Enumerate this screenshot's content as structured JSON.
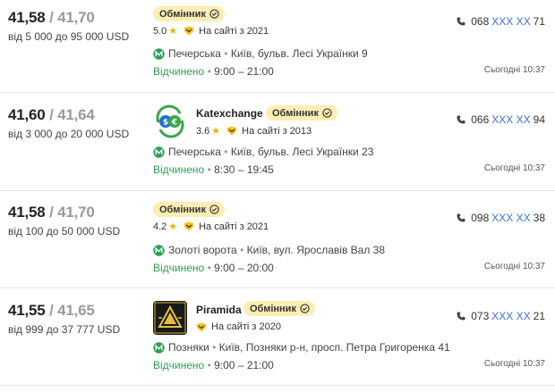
{
  "offers": [
    {
      "buy": "41,58",
      "sell": "41,70",
      "range": "від 5 000 до 95 000 USD",
      "name": "",
      "badge": "Обмінник",
      "rating": "5.0",
      "since": "На сайті з 2021",
      "metro": "Печерська",
      "address": "Київ, бульв. Лесі Українки 9",
      "status": "Відчинено",
      "hours": "9:00 – 21:00",
      "phone_prefix": "068",
      "phone_hidden": "XXX XX",
      "phone_suffix": "71",
      "updated": "Сьогодні 10:37"
    },
    {
      "buy": "41,60",
      "sell": "41,64",
      "range": "від 3 000 до 20 000 USD",
      "name": "Katexchange",
      "badge": "Обмінник",
      "rating": "3.6",
      "since": "На сайті з 2013",
      "metro": "Печерська",
      "address": "Київ, бульв. Лесі Українки 23",
      "status": "Відчинено",
      "hours": "8:30 – 19:45",
      "phone_prefix": "066",
      "phone_hidden": "XXX XX",
      "phone_suffix": "94",
      "updated": "Сьогодні 10:37"
    },
    {
      "buy": "41,58",
      "sell": "41,70",
      "range": "від 100 до 50 000 USD",
      "name": "",
      "badge": "Обмінник",
      "rating": "4.2",
      "since": "На сайті з 2021",
      "metro": "Золоті ворота",
      "address": "Київ, вул. Ярославів Вал 38",
      "status": "Відчинено",
      "hours": "9:00 – 20:00",
      "phone_prefix": "098",
      "phone_hidden": "XXX XX",
      "phone_suffix": "38",
      "updated": "Сьогодні 10:37"
    },
    {
      "buy": "41,55",
      "sell": "41,65",
      "range": "від 999 до 37 777 USD",
      "name": "Piramida",
      "badge": "Обмінник",
      "rating": "",
      "since": "На сайті з 2020",
      "metro": "Позняки",
      "address": "Київ, Позняки р-н, просп. Петра Григоренка 41",
      "status": "Відчинено",
      "hours": "9:00 – 21:00",
      "phone_prefix": "073",
      "phone_hidden": "XXX XX",
      "phone_suffix": "21",
      "updated": "Сьогодні 10:37"
    }
  ],
  "icons": {
    "metro": "metro-m-icon",
    "verified": "check-circle-icon",
    "since": "award-badge-icon",
    "phone": "phone-icon",
    "star": "star-icon"
  },
  "colors": {
    "badge_bg": "#fdeeb4",
    "open": "#2e9e57",
    "phone_hidden": "#3c6fd6",
    "star": "#f2b200",
    "metro": "#2e9e57"
  },
  "separators": {
    "rate": "/",
    "meta": "•"
  }
}
